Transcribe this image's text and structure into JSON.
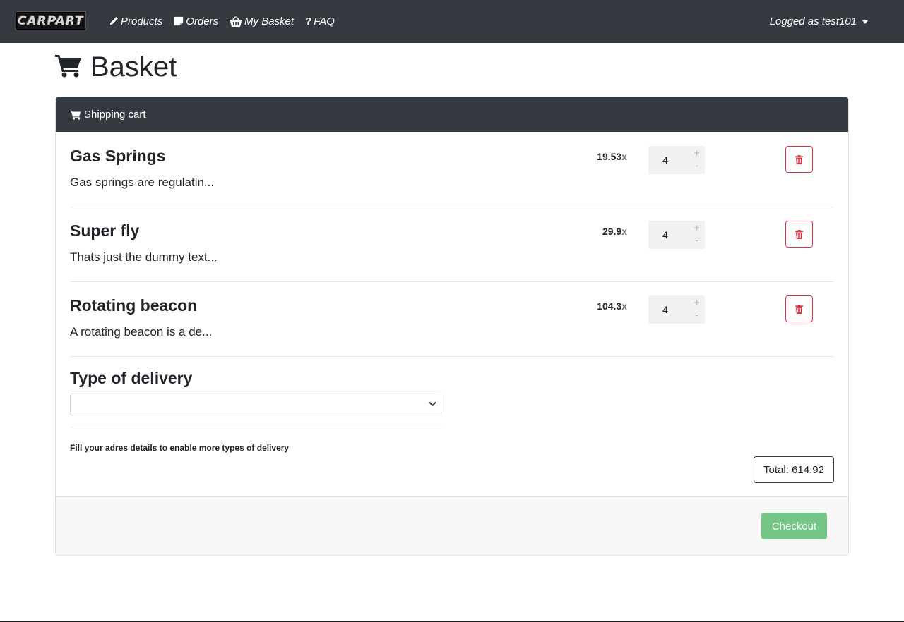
{
  "navbar": {
    "brand": "CARPART",
    "links": [
      {
        "label": "Products",
        "icon": "pencil-icon"
      },
      {
        "label": "Orders",
        "icon": "note-icon"
      },
      {
        "label": "My Basket",
        "icon": "basket-icon"
      },
      {
        "label": "FAQ",
        "icon": "question-icon"
      }
    ],
    "user": "Logged as test101"
  },
  "page": {
    "title": "Basket",
    "title_icon": "cart-icon"
  },
  "cart": {
    "header": "Shipping cart",
    "items": [
      {
        "name": "Gas Springs",
        "description": "Gas springs are regulatin...",
        "price": "19.53",
        "multiplier": "x",
        "quantity": "4"
      },
      {
        "name": "Super fly",
        "description": "Thats just the dummy text...",
        "price": "29.9",
        "multiplier": "x",
        "quantity": "4"
      },
      {
        "name": "Rotating beacon",
        "description": "A rotating beacon is a de...",
        "price": "104.3",
        "multiplier": "x",
        "quantity": "4"
      }
    ],
    "qty_plus": "+",
    "qty_minus": "-",
    "delivery": {
      "title": "Type of delivery",
      "selected": "",
      "note": "Fill your adres details to enable more types of delivery"
    },
    "total": "Total: 614.92",
    "checkout_label": "Checkout"
  },
  "colors": {
    "navbar": "#343a40",
    "danger": "#dc3545",
    "checkout": "#74c687"
  }
}
